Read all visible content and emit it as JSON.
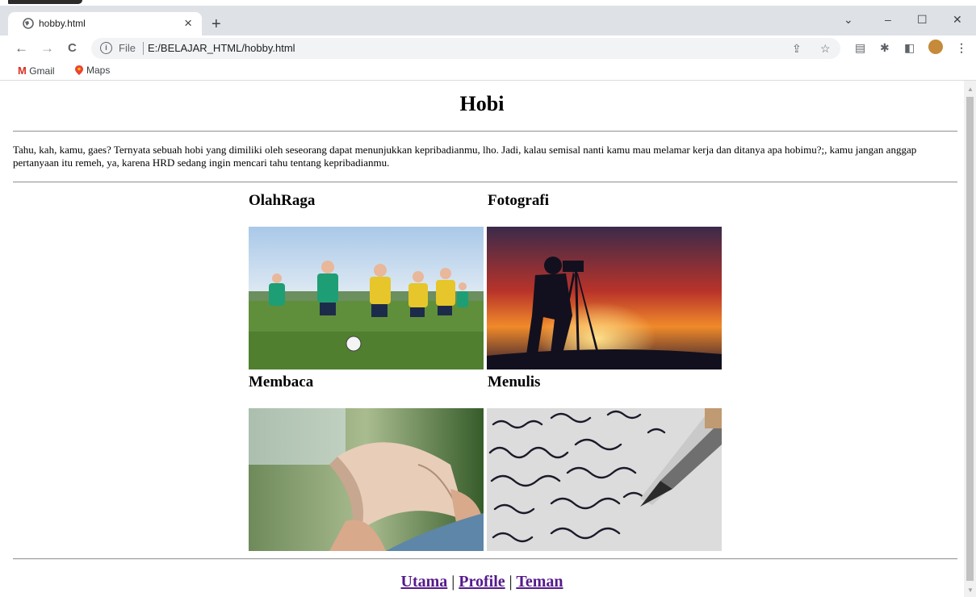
{
  "browser": {
    "tab_title": "hobby.html",
    "tab_close": "×",
    "new_tab": "+",
    "window_controls": {
      "minimize": "–",
      "maximize": "☐",
      "close": "✕",
      "dropdown": "⌄"
    },
    "nav": {
      "back": "←",
      "forward": "→",
      "reload": "C"
    },
    "address": {
      "scheme_label": "File",
      "url": "E:/BELAJAR_HTML/hobby.html"
    },
    "bookmarks": [
      {
        "label": "Gmail",
        "icon": "gmail-icon"
      },
      {
        "label": "Maps",
        "icon": "maps-icon"
      }
    ],
    "colors": {
      "tabbar": "#dee1e6",
      "omnibox": "#f1f3f4"
    }
  },
  "page": {
    "title": "Hobi",
    "intro": "Tahu, kah, kamu, gaes? Ternyata sebuah hobi yang dimiliki oleh seseorang dapat menunjukkan kepribadianmu, lho. Jadi, kalau semisal nanti kamu mau melamar kerja dan ditanya apa hobimu?;, kamu jangan anggap pertanyaan itu remeh, ya, karena HRD sedang ingin mencari tahu tentang kepribadianmu.",
    "hobbies": [
      {
        "heading": "OlahRaga"
      },
      {
        "heading": "Fotografi"
      },
      {
        "heading": "Membaca"
      },
      {
        "heading": "Menulis"
      }
    ],
    "footer": {
      "links": [
        "Utama",
        "Profile",
        "Teman"
      ],
      "separator": "|",
      "link_color": "#551a8b"
    }
  }
}
